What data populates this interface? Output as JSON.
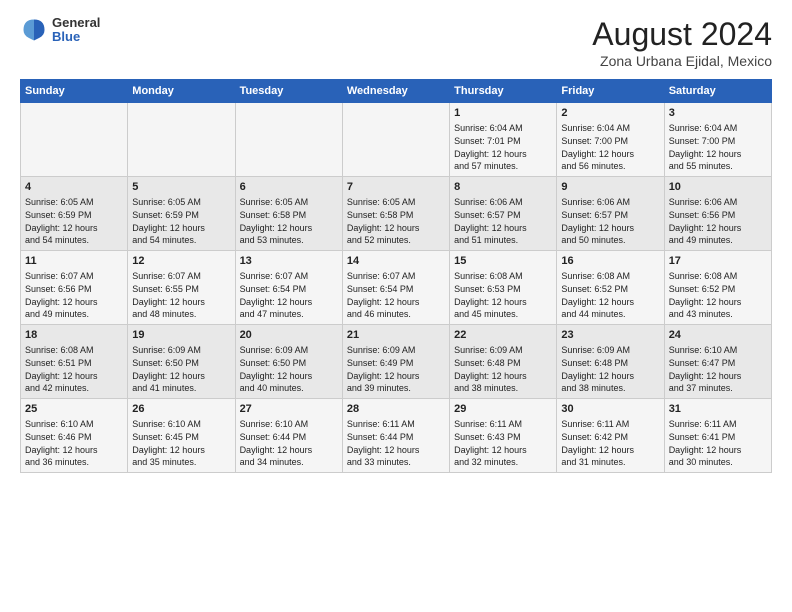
{
  "logo": {
    "general": "General",
    "blue": "Blue"
  },
  "header": {
    "title": "August 2024",
    "subtitle": "Zona Urbana Ejidal, Mexico"
  },
  "days_of_week": [
    "Sunday",
    "Monday",
    "Tuesday",
    "Wednesday",
    "Thursday",
    "Friday",
    "Saturday"
  ],
  "weeks": [
    [
      {
        "day": "",
        "content": ""
      },
      {
        "day": "",
        "content": ""
      },
      {
        "day": "",
        "content": ""
      },
      {
        "day": "",
        "content": ""
      },
      {
        "day": "1",
        "content": "Sunrise: 6:04 AM\nSunset: 7:01 PM\nDaylight: 12 hours\nand 57 minutes."
      },
      {
        "day": "2",
        "content": "Sunrise: 6:04 AM\nSunset: 7:00 PM\nDaylight: 12 hours\nand 56 minutes."
      },
      {
        "day": "3",
        "content": "Sunrise: 6:04 AM\nSunset: 7:00 PM\nDaylight: 12 hours\nand 55 minutes."
      }
    ],
    [
      {
        "day": "4",
        "content": "Sunrise: 6:05 AM\nSunset: 6:59 PM\nDaylight: 12 hours\nand 54 minutes."
      },
      {
        "day": "5",
        "content": "Sunrise: 6:05 AM\nSunset: 6:59 PM\nDaylight: 12 hours\nand 54 minutes."
      },
      {
        "day": "6",
        "content": "Sunrise: 6:05 AM\nSunset: 6:58 PM\nDaylight: 12 hours\nand 53 minutes."
      },
      {
        "day": "7",
        "content": "Sunrise: 6:05 AM\nSunset: 6:58 PM\nDaylight: 12 hours\nand 52 minutes."
      },
      {
        "day": "8",
        "content": "Sunrise: 6:06 AM\nSunset: 6:57 PM\nDaylight: 12 hours\nand 51 minutes."
      },
      {
        "day": "9",
        "content": "Sunrise: 6:06 AM\nSunset: 6:57 PM\nDaylight: 12 hours\nand 50 minutes."
      },
      {
        "day": "10",
        "content": "Sunrise: 6:06 AM\nSunset: 6:56 PM\nDaylight: 12 hours\nand 49 minutes."
      }
    ],
    [
      {
        "day": "11",
        "content": "Sunrise: 6:07 AM\nSunset: 6:56 PM\nDaylight: 12 hours\nand 49 minutes."
      },
      {
        "day": "12",
        "content": "Sunrise: 6:07 AM\nSunset: 6:55 PM\nDaylight: 12 hours\nand 48 minutes."
      },
      {
        "day": "13",
        "content": "Sunrise: 6:07 AM\nSunset: 6:54 PM\nDaylight: 12 hours\nand 47 minutes."
      },
      {
        "day": "14",
        "content": "Sunrise: 6:07 AM\nSunset: 6:54 PM\nDaylight: 12 hours\nand 46 minutes."
      },
      {
        "day": "15",
        "content": "Sunrise: 6:08 AM\nSunset: 6:53 PM\nDaylight: 12 hours\nand 45 minutes."
      },
      {
        "day": "16",
        "content": "Sunrise: 6:08 AM\nSunset: 6:52 PM\nDaylight: 12 hours\nand 44 minutes."
      },
      {
        "day": "17",
        "content": "Sunrise: 6:08 AM\nSunset: 6:52 PM\nDaylight: 12 hours\nand 43 minutes."
      }
    ],
    [
      {
        "day": "18",
        "content": "Sunrise: 6:08 AM\nSunset: 6:51 PM\nDaylight: 12 hours\nand 42 minutes."
      },
      {
        "day": "19",
        "content": "Sunrise: 6:09 AM\nSunset: 6:50 PM\nDaylight: 12 hours\nand 41 minutes."
      },
      {
        "day": "20",
        "content": "Sunrise: 6:09 AM\nSunset: 6:50 PM\nDaylight: 12 hours\nand 40 minutes."
      },
      {
        "day": "21",
        "content": "Sunrise: 6:09 AM\nSunset: 6:49 PM\nDaylight: 12 hours\nand 39 minutes."
      },
      {
        "day": "22",
        "content": "Sunrise: 6:09 AM\nSunset: 6:48 PM\nDaylight: 12 hours\nand 38 minutes."
      },
      {
        "day": "23",
        "content": "Sunrise: 6:09 AM\nSunset: 6:48 PM\nDaylight: 12 hours\nand 38 minutes."
      },
      {
        "day": "24",
        "content": "Sunrise: 6:10 AM\nSunset: 6:47 PM\nDaylight: 12 hours\nand 37 minutes."
      }
    ],
    [
      {
        "day": "25",
        "content": "Sunrise: 6:10 AM\nSunset: 6:46 PM\nDaylight: 12 hours\nand 36 minutes."
      },
      {
        "day": "26",
        "content": "Sunrise: 6:10 AM\nSunset: 6:45 PM\nDaylight: 12 hours\nand 35 minutes."
      },
      {
        "day": "27",
        "content": "Sunrise: 6:10 AM\nSunset: 6:44 PM\nDaylight: 12 hours\nand 34 minutes."
      },
      {
        "day": "28",
        "content": "Sunrise: 6:11 AM\nSunset: 6:44 PM\nDaylight: 12 hours\nand 33 minutes."
      },
      {
        "day": "29",
        "content": "Sunrise: 6:11 AM\nSunset: 6:43 PM\nDaylight: 12 hours\nand 32 minutes."
      },
      {
        "day": "30",
        "content": "Sunrise: 6:11 AM\nSunset: 6:42 PM\nDaylight: 12 hours\nand 31 minutes."
      },
      {
        "day": "31",
        "content": "Sunrise: 6:11 AM\nSunset: 6:41 PM\nDaylight: 12 hours\nand 30 minutes."
      }
    ]
  ]
}
